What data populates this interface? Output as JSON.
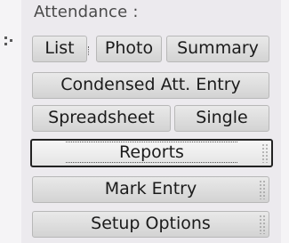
{
  "section": {
    "title": "Attendance :"
  },
  "buttons": {
    "list": "List",
    "photo": "Photo",
    "summary": "Summary",
    "condensed": "Condensed Att. Entry",
    "spreadsheet": "Spreadsheet",
    "single": "Single",
    "reports": "Reports",
    "mark_entry": "Mark Entry",
    "setup_options": "Setup Options"
  },
  "state": {
    "selected_button": "Reports"
  }
}
